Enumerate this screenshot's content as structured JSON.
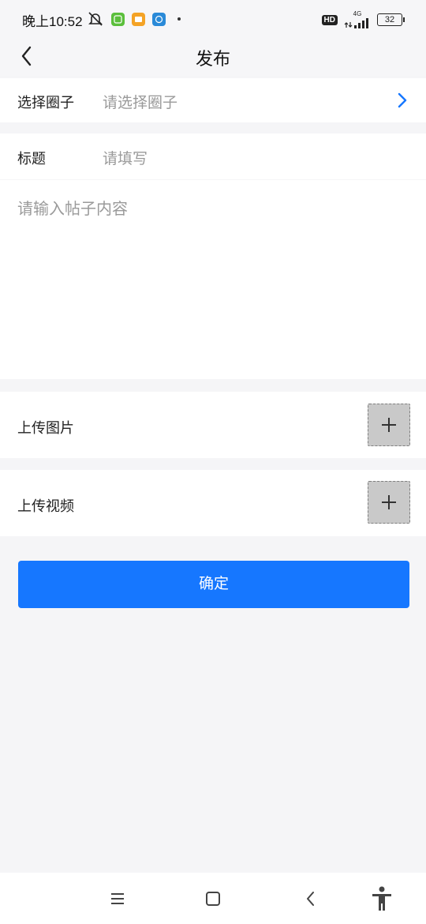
{
  "status": {
    "time": "晚上10:52",
    "network": "4G",
    "battery": "32",
    "hd": "HD"
  },
  "header": {
    "title": "发布"
  },
  "form": {
    "circle": {
      "label": "选择圈子",
      "placeholder": "请选择圈子"
    },
    "title": {
      "label": "标题",
      "placeholder": "请填写"
    },
    "content": {
      "placeholder": "请输入帖子内容"
    },
    "upload_image": {
      "label": "上传图片"
    },
    "upload_video": {
      "label": "上传视频"
    }
  },
  "confirm_button": {
    "label": "确定"
  },
  "colors": {
    "accent": "#1677ff",
    "page_bg": "#f5f5f7",
    "upload_bg": "#c9c9c9"
  }
}
